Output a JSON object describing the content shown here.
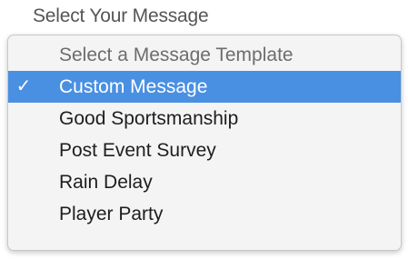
{
  "select": {
    "label": "Select Your Message",
    "options": [
      {
        "label": "Select a Message Template",
        "selected": false
      },
      {
        "label": "Custom Message",
        "selected": true
      },
      {
        "label": "Good Sportsmanship",
        "selected": false
      },
      {
        "label": "Post Event Survey",
        "selected": false
      },
      {
        "label": "Rain Delay",
        "selected": false
      },
      {
        "label": "Player Party",
        "selected": false
      }
    ],
    "checkmark": "✓",
    "checkmark_icon": "checkmark-icon"
  },
  "colors": {
    "selection": "#4a90e2",
    "menu_background": "#f4f4f4"
  }
}
